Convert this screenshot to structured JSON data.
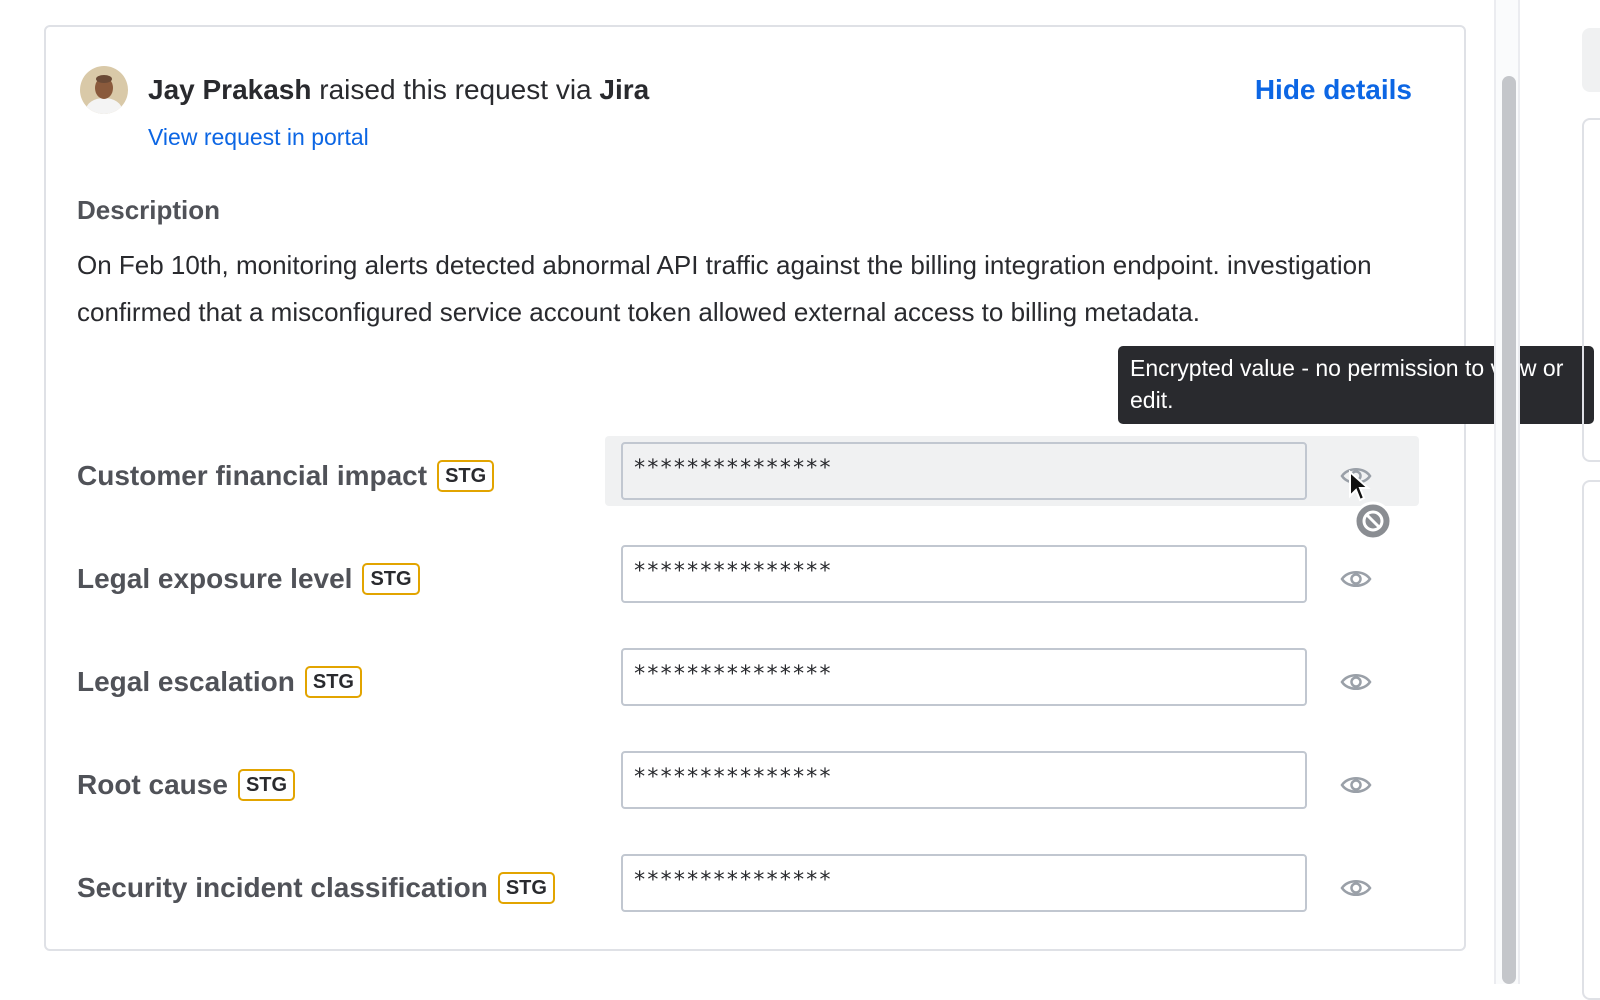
{
  "request": {
    "requester": "Jay Prakash",
    "raised_text": " raised this request via ",
    "channel": "Jira",
    "hide_details": "Hide details",
    "view_portal": "View request in portal"
  },
  "description": {
    "label": "Description",
    "text": "On Feb 10th, monitoring alerts detected abnormal API traffic against the billing integration endpoint. investigation confirmed that a misconfigured service account token allowed external access to billing metadata."
  },
  "fields": [
    {
      "label": "Customer financial impact",
      "badge": "STG",
      "value": "***************"
    },
    {
      "label": "Legal exposure level",
      "badge": "STG",
      "value": "***************"
    },
    {
      "label": "Legal escalation",
      "badge": "STG",
      "value": "***************"
    },
    {
      "label": "Root cause",
      "badge": "STG",
      "value": "***************"
    },
    {
      "label": "Security incident classification",
      "badge": "STG",
      "value": "***************"
    }
  ],
  "tooltip": {
    "text": "Encrypted value - no permission to view or edit."
  },
  "colors": {
    "link": "#0c66e4",
    "badge_border": "#e2a400",
    "tooltip_bg": "#292a2e"
  },
  "icons": {
    "eye": "eye-icon",
    "cursor": "arrow-cursor-icon",
    "not_allowed": "not-allowed-icon"
  }
}
